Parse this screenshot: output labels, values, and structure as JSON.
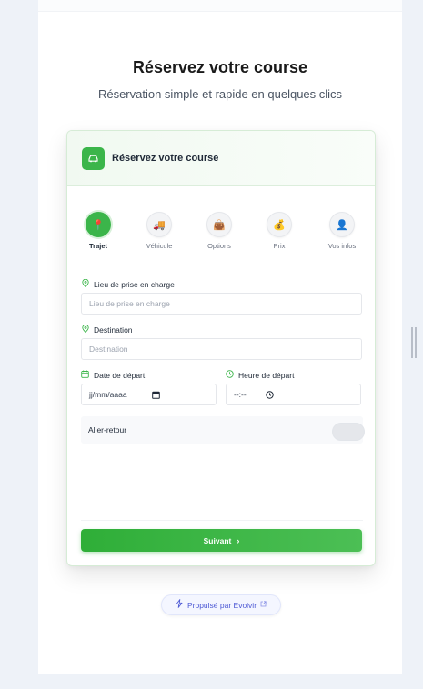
{
  "page": {
    "title": "Réservez votre course",
    "subtitle": "Réservation simple et rapide en quelques clics"
  },
  "card": {
    "header_title": "Réservez votre course",
    "header_icon": "car-icon"
  },
  "steps": [
    {
      "label": "Trajet",
      "icon": "map-pin-icon",
      "glyph": "📍",
      "active": true
    },
    {
      "label": "Véhicule",
      "icon": "truck-icon",
      "glyph": "🚚",
      "active": false
    },
    {
      "label": "Options",
      "icon": "bag-icon",
      "glyph": "👜",
      "active": false
    },
    {
      "label": "Prix",
      "icon": "money-bag-icon",
      "glyph": "💰",
      "active": false
    },
    {
      "label": "Vos infos",
      "icon": "user-icon",
      "glyph": "👤",
      "active": false
    }
  ],
  "form": {
    "pickup_label": "Lieu de prise en charge",
    "pickup_placeholder": "Lieu de prise en charge",
    "destination_label": "Destination",
    "destination_placeholder": "Destination",
    "date_label": "Date de départ",
    "date_value": "jj/mm/aaaa",
    "time_label": "Heure de départ",
    "time_value": "--:--",
    "round_trip_label": "Aller-retour",
    "round_trip_on": false
  },
  "actions": {
    "next_label": "Suivant",
    "next_glyph": "›"
  },
  "powered": {
    "label": "Propulsé par Evolvir"
  },
  "colors": {
    "accent": "#3bb54a",
    "powered_text": "#4f5bd5"
  }
}
